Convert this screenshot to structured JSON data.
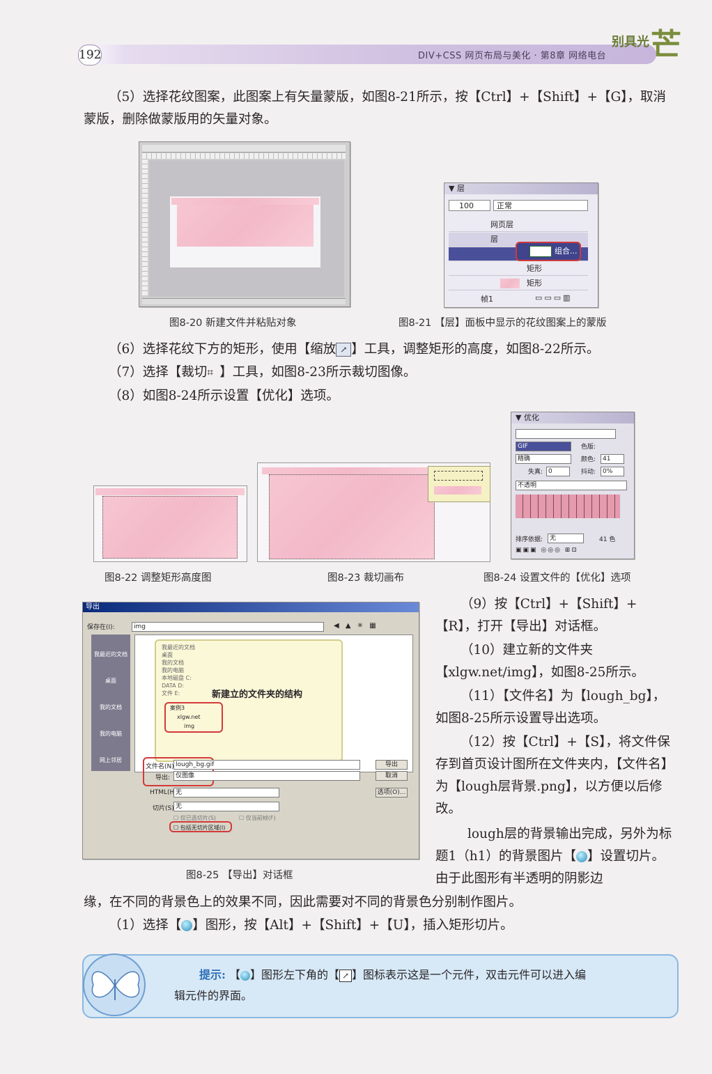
{
  "header": {
    "page_number": "192",
    "running_title": "DIV+CSS 网页布局与美化 · 第8章   网络电台",
    "brand": "别具光",
    "brand_mark": "芒"
  },
  "paragraphs": {
    "p5": "（5）选择花纹图案，此图案上有矢量蒙版，如图8-21所示，按【Ctrl】+【Shift】+【G】，取消蒙版，删除做蒙版用的矢量对象。",
    "p6": "（6）选择花纹下方的矩形，使用【缩放",
    "p6_end": "】工具，调整矩形的高度，如图8-22所示。",
    "p7": "（7）选择【裁切",
    "p7_end": "】工具，如图8-23所示裁切图像。",
    "p8": "（8）如图8-24所示设置【优化】选项。",
    "p9": "（9）按【Ctrl】+【Shift】+【R】，打开【导出】对话框。",
    "p10": "（10）建立新的文件夹【xlgw.net/img】，如图8-25所示。",
    "p11": "（11）【文件名】为【lough_bg】，如图8-25所示设置导出选项。",
    "p12": "（12）按【Ctrl】+【S】，将文件保存到首页设计图所在文件夹内，【文件名】为【lough层背景.png】，以方便以后修改。",
    "p13a": "lough层的背景输出完成，另外为标题1（h1）的背景图片【",
    "p13b": "】设置切片。由于此图形有半透明的阴影边",
    "p13c": "缘，在不同的背景色上的效果不同，因此需要对不同的背景色分别制作图片。",
    "p14a": "（1）选择【",
    "p14b": "】图形，按【Alt】+【Shift】+【U】，插入矩形切片。"
  },
  "captions": {
    "fig20": "图8-20   新建文件并粘贴对象",
    "fig21": "图8-21   【层】面板中显示的花纹图案上的蒙版",
    "fig22": "图8-22   调整矩形高度图",
    "fig23": "图8-23   裁切画布",
    "fig24": "图8-24   设置文件的【优化】选项",
    "fig25": "图8-25   【导出】对话框"
  },
  "layers_panel": {
    "title": "层",
    "opacity": "100",
    "blend_mode": "正常",
    "layer_web": "网页层",
    "layer_main": "层",
    "object_group": "组合...",
    "object_rect1": "矩形",
    "object_rect2": "矩形",
    "frame": "帧1"
  },
  "optimize_panel": {
    "title": "优化",
    "format": "GIF",
    "palette": "精确",
    "matte_label": "色版:",
    "colors_label": "颜色:",
    "colors_value": "41",
    "loss_label": "失真:",
    "loss_value": "0",
    "dither_label": "抖动:",
    "dither_value": "0%",
    "transparency": "不透明",
    "sort_label": "排序依据:",
    "sort_value": "无",
    "color_count": "41 色"
  },
  "export_dialog": {
    "title": "导出",
    "save_in_label": "保存在(I):",
    "save_in_value": "img",
    "annotation": "新建立的文件夹的结构",
    "folder_parent": "案例3",
    "folder_site": "xlgw.net",
    "folder_img": "img",
    "tree_items": [
      "我最近的文档",
      "桌面",
      "我的文档",
      "我的电脑",
      "本地磁盘 C:",
      "DATA D:",
      "文件 E:"
    ],
    "places": [
      "我最近的文档",
      "桌面",
      "我的文档",
      "我的电脑",
      "网上邻居"
    ],
    "filename_label": "文件名(N):",
    "filename_value": "lough_bg.gif",
    "export_label": "导出:",
    "export_value": "仅图像",
    "html_label": "HTML(H):",
    "html_value": "无",
    "slices_label": "切片(S):",
    "slices_value": "无",
    "checkbox_selected_only": "仅已选切片(S)",
    "checkbox_current_frame": "仅当前帧(F)",
    "checkbox_include_area": "包括无切片区域(I)",
    "export_button": "导出",
    "cancel_button": "取消",
    "options_button": "选项(O)..."
  },
  "tip": {
    "label": "提示:",
    "text_a": "【",
    "text_b": "】图形左下角的【",
    "text_c": "】图标表示这是一个元件，双击元件可以进入编",
    "text_d": "辑元件的界面。"
  },
  "colors": {
    "accent_pink": "#f5bccb",
    "highlight_red": "#d23a3a",
    "tip_bg": "#d7e9f7",
    "header_purple": "#cfbfe0"
  }
}
